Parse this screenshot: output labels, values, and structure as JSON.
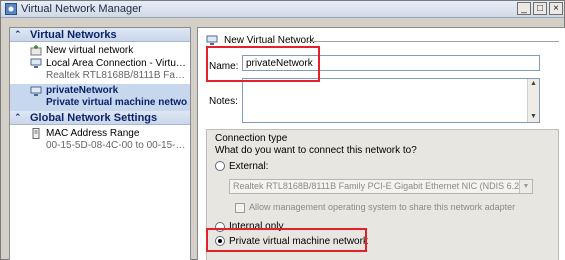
{
  "window": {
    "title": "Virtual Network Manager",
    "minimize_glyph": "_",
    "maximize_glyph": "□",
    "close_glyph": "×"
  },
  "sidebar": {
    "virtual_networks_heading": "Virtual Networks",
    "items": [
      {
        "label": "New virtual network",
        "icon": "new-network-icon"
      },
      {
        "label": "Local Area Connection - Virtual Net...",
        "sub": "Realtek RTL8168B/8111B Family P...",
        "icon": "network-icon"
      },
      {
        "label": "privateNetwork",
        "sub": "Private virtual machine netwo...",
        "icon": "network-icon",
        "selected": true
      }
    ],
    "global_heading": "Global Network Settings",
    "global_items": [
      {
        "label": "MAC Address Range",
        "sub": "00-15-5D-08-4C-00 to 00-15-5D-0...",
        "icon": "mac-range-icon"
      }
    ]
  },
  "main": {
    "section_title": "New Virtual Network",
    "name_label": "Name:",
    "name_value": "privateNetwork",
    "notes_label": "Notes:",
    "notes_value": "",
    "connection_type": {
      "title": "Connection type",
      "question": "What do you want to connect this network to?",
      "external_label": "External:",
      "adapter_value": "Realtek RTL8168B/8111B Family PCI-E Gigabit Ethernet NIC (NDIS 6.20)",
      "allow_mgmt_label": "Allow management operating system to share this network adapter",
      "internal_label": "Internal only",
      "private_label": "Private virtual machine network",
      "selected": "private"
    }
  },
  "colors": {
    "highlight": "#e3212b",
    "heading_text": "#0a246a",
    "selection_bg": "#c7d7ee"
  }
}
